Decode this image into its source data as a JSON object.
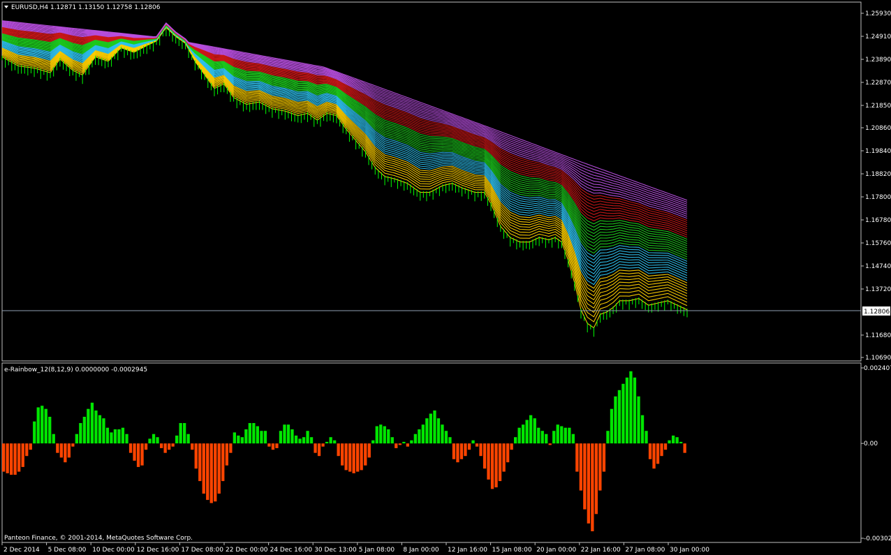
{
  "window": {
    "main_title": "EURUSD,H4  1.12871  1.13150  1.12758  1.12806",
    "indicator_title": "e-Rainbow_12(8,12,9) 0.0000000 -0.0002945",
    "copyright": "Panteon Finance, © 2001-2014, MetaQuotes Software Corp."
  },
  "colors": {
    "background": "#000000",
    "frame": "#c0c0c0",
    "text": "#ffffff",
    "candle": "#00ff00",
    "hist_up": "#00e600",
    "hist_down": "#ff4400",
    "current_line": "#8fa0b4",
    "ribbon": [
      "#b94fe0",
      "#d01818",
      "#1ecf1e",
      "#2ec2ef",
      "#ffd000"
    ]
  },
  "chart_data": [
    {
      "type": "line",
      "title": "EURUSD,H4",
      "ohlc_header": {
        "open": 1.12871,
        "high": 1.1315,
        "low": 1.12758,
        "close": 1.12806
      },
      "current_price": 1.12806,
      "ylim": [
        1.1069,
        1.2593
      ],
      "y_ticks": [
        "1.25930",
        "1.24910",
        "1.23890",
        "1.22870",
        "1.21850",
        "1.20860",
        "1.19840",
        "1.18820",
        "1.17800",
        "1.16780",
        "1.15760",
        "1.14740",
        "1.13720",
        "1.11680",
        "1.10690"
      ],
      "x_ticks": [
        "2 Dec 2014",
        "5 Dec 08:00",
        "10 Dec 00:00",
        "12 Dec 16:00",
        "17 Dec 08:00",
        "22 Dec 00:00",
        "24 Dec 16:00",
        "30 Dec 13:00",
        "5 Jan 08:00",
        "8 Jan 00:00",
        "12 Jan 16:00",
        "15 Jan 08:00",
        "20 Jan 00:00",
        "22 Jan 16:00",
        "27 Jan 08:00",
        "30 Jan 00:00"
      ],
      "price_path": [
        [
          0,
          1.24
        ],
        [
          5,
          1.236
        ],
        [
          10,
          1.235
        ],
        [
          15,
          1.233
        ],
        [
          18,
          1.239
        ],
        [
          22,
          1.234
        ],
        [
          25,
          1.232
        ],
        [
          29,
          1.24
        ],
        [
          33,
          1.238
        ],
        [
          37,
          1.244
        ],
        [
          41,
          1.242
        ],
        [
          45,
          1.245
        ],
        [
          48,
          1.247
        ],
        [
          51,
          1.253
        ],
        [
          54,
          1.249
        ],
        [
          57,
          1.246
        ],
        [
          60,
          1.238
        ],
        [
          63,
          1.232
        ],
        [
          66,
          1.226
        ],
        [
          69,
          1.228
        ],
        [
          72,
          1.222
        ],
        [
          76,
          1.219
        ],
        [
          80,
          1.22
        ],
        [
          84,
          1.217
        ],
        [
          88,
          1.216
        ],
        [
          92,
          1.214
        ],
        [
          95,
          1.215
        ],
        [
          98,
          1.212
        ],
        [
          101,
          1.215
        ],
        [
          104,
          1.214
        ],
        [
          107,
          1.208
        ],
        [
          110,
          1.203
        ],
        [
          113,
          1.198
        ],
        [
          116,
          1.191
        ],
        [
          119,
          1.187
        ],
        [
          122,
          1.186
        ],
        [
          126,
          1.184
        ],
        [
          130,
          1.18
        ],
        [
          133,
          1.18
        ],
        [
          137,
          1.183
        ],
        [
          140,
          1.184
        ],
        [
          143,
          1.182
        ],
        [
          147,
          1.18
        ],
        [
          150,
          1.18
        ],
        [
          152,
          1.175
        ],
        [
          155,
          1.165
        ],
        [
          158,
          1.16
        ],
        [
          161,
          1.158
        ],
        [
          164,
          1.158
        ],
        [
          167,
          1.16
        ],
        [
          170,
          1.159
        ],
        [
          172,
          1.16
        ],
        [
          174,
          1.158
        ],
        [
          176,
          1.15
        ],
        [
          178,
          1.14
        ],
        [
          180,
          1.128
        ],
        [
          182,
          1.122
        ],
        [
          184,
          1.12
        ],
        [
          186,
          1.126
        ],
        [
          188,
          1.127
        ],
        [
          190,
          1.129
        ],
        [
          192,
          1.132
        ],
        [
          195,
          1.132
        ],
        [
          198,
          1.133
        ],
        [
          201,
          1.13
        ],
        [
          204,
          1.131
        ],
        [
          207,
          1.132
        ],
        [
          210,
          1.13
        ],
        [
          213,
          1.128
        ]
      ],
      "ribbon_top": [
        [
          0,
          1.256
        ],
        [
          50,
          1.2485
        ],
        [
          100,
          1.2355
        ],
        [
          150,
          1.2095
        ],
        [
          180,
          1.1935
        ],
        [
          213,
          1.1765
        ]
      ]
    },
    {
      "type": "bar",
      "title": "e-Rainbow_12(8,12,9)",
      "ylim": [
        -0.003022,
        0.002407
      ],
      "y_ticks": [
        "0.002407",
        "0.00",
        "-0.003022"
      ],
      "values": [
        -0.0009,
        -0.00095,
        -0.001,
        -0.001,
        -0.0009,
        -0.00075,
        -0.0004,
        -0.0002,
        0.0007,
        0.00115,
        0.0012,
        0.0011,
        0.00085,
        0.0003,
        -0.0003,
        -0.00045,
        -0.0006,
        -0.00045,
        -0.0001,
        0.0003,
        0.00065,
        0.00085,
        0.0011,
        0.0013,
        0.00105,
        0.0009,
        0.0008,
        0.0005,
        0.00035,
        0.00045,
        0.00045,
        0.0005,
        0.0003,
        -0.0003,
        -0.00055,
        -0.00075,
        -0.0007,
        -0.0002,
        0.00015,
        0.0003,
        0.0002,
        -0.00015,
        -0.0003,
        -0.0002,
        -0.0001,
        0.00025,
        0.00065,
        0.00065,
        0.0003,
        -0.0002,
        -0.0008,
        -0.0012,
        -0.0016,
        -0.0018,
        -0.0019,
        -0.00185,
        -0.0016,
        -0.0012,
        -0.0007,
        -0.0003,
        0.00035,
        0.00025,
        0.0002,
        0.00045,
        0.00065,
        0.00065,
        0.00055,
        0.0004,
        0.0004,
        -0.0001,
        -0.0002,
        -0.00015,
        0.0004,
        0.0006,
        0.0006,
        0.00045,
        0.00025,
        0.00015,
        0.0002,
        0.0004,
        0.0002,
        -0.0003,
        -0.0004,
        -0.0001,
        5e-05,
        0.0002,
        0.0001,
        -0.0004,
        -0.0007,
        -0.00085,
        -0.0009,
        -0.00095,
        -0.0009,
        -0.00085,
        -0.0007,
        -0.00045,
        0.0001,
        0.00055,
        0.0006,
        0.00055,
        0.00045,
        0.0002,
        -0.00015,
        -5e-05,
        5e-05,
        -0.0001,
        0.0001,
        0.0003,
        0.00045,
        0.0006,
        0.0008,
        0.00095,
        0.00105,
        0.0008,
        0.0006,
        0.0004,
        0.0002,
        -0.0005,
        -0.0006,
        -0.0005,
        -0.0004,
        -0.0002,
        0.0001,
        -0.0001,
        -0.0004,
        -0.0008,
        -0.00115,
        -0.00145,
        -0.0014,
        -0.0012,
        -0.0009,
        -0.0006,
        -0.0002,
        0.0002,
        0.0005,
        0.0006,
        0.00075,
        0.0009,
        0.0008,
        0.0005,
        0.0004,
        0.0003,
        -5e-05,
        0.0004,
        0.0006,
        0.00055,
        0.0005,
        0.0005,
        0.0003,
        -0.0009,
        -0.0015,
        -0.0021,
        -0.00255,
        -0.0028,
        -0.00225,
        -0.0015,
        -0.0009,
        0.0004,
        0.0011,
        0.0015,
        0.0017,
        0.0019,
        0.0021,
        0.0023,
        0.0021,
        0.0015,
        0.0009,
        0.0004,
        -0.0005,
        -0.0008,
        -0.00065,
        -0.0004,
        -0.0002,
        0.0001,
        0.00025,
        0.0002,
        5e-05,
        -0.0003
      ]
    }
  ]
}
